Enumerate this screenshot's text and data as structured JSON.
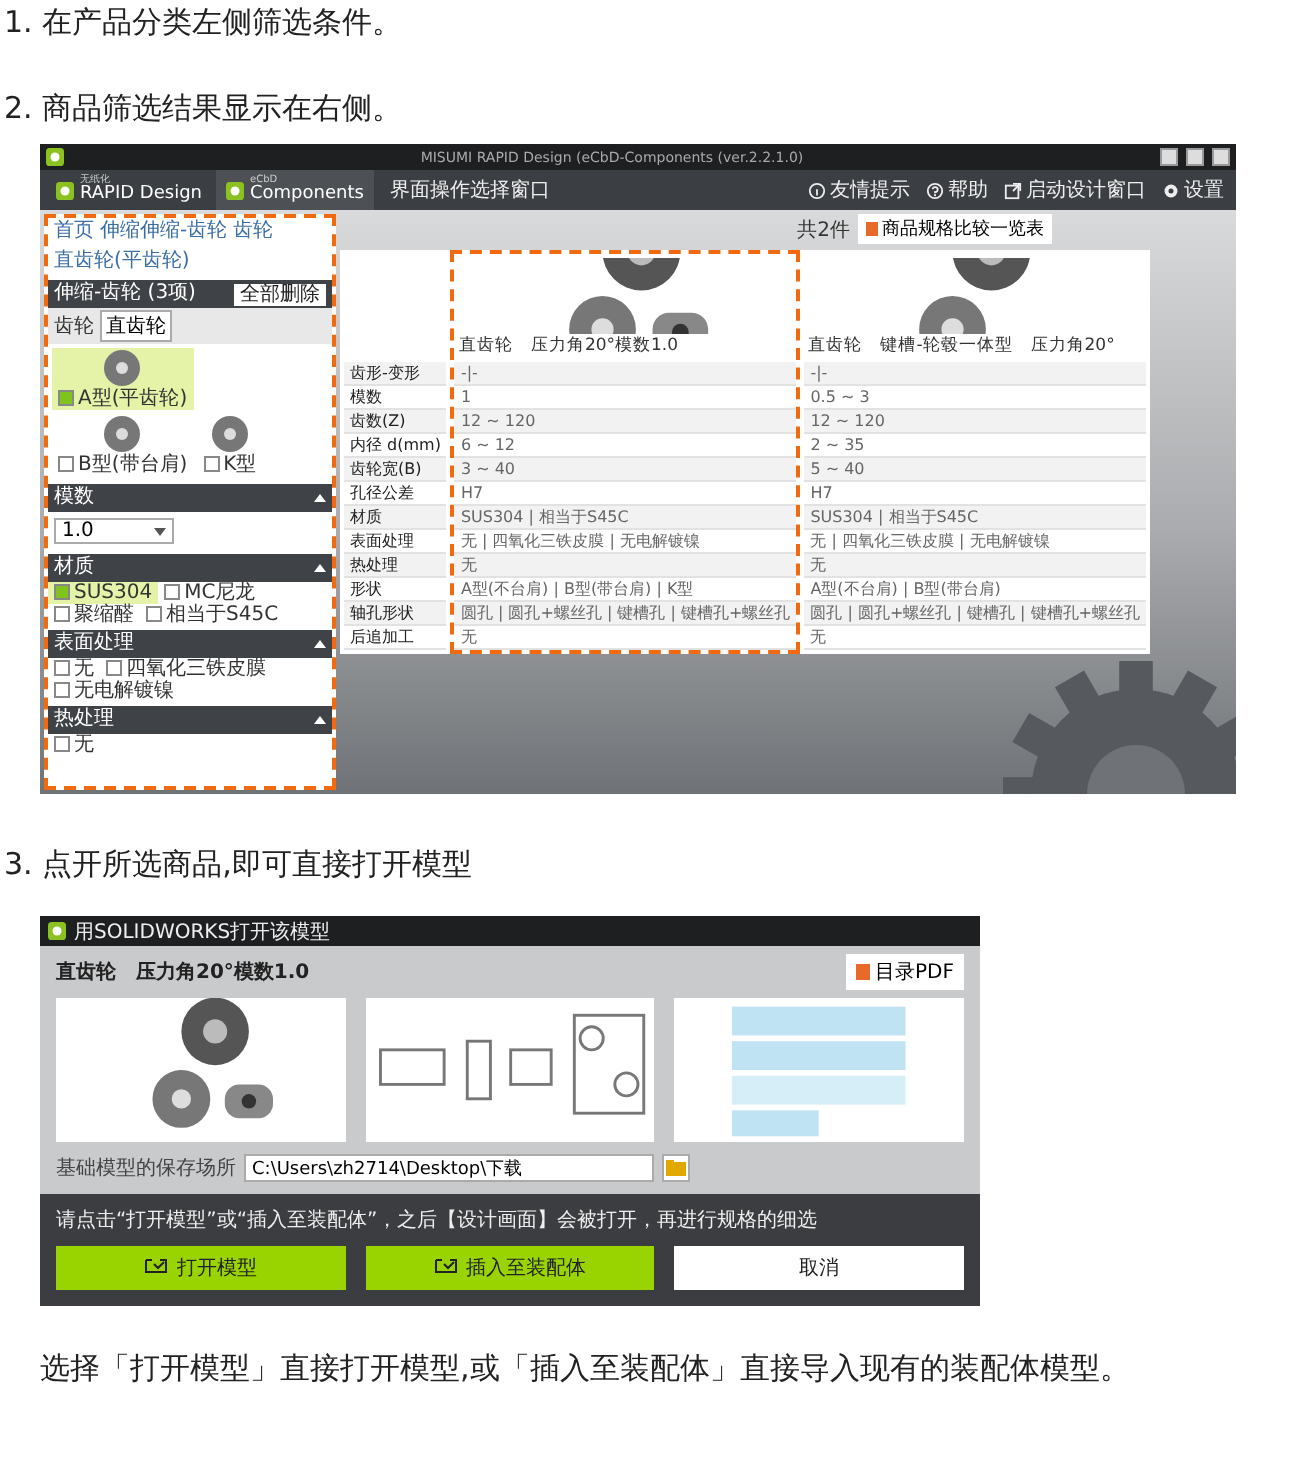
{
  "steps": [
    {
      "text": "1. 在产品分类左侧筛选条件。"
    },
    {
      "text": "2. 商品筛选结果显示在右侧。"
    },
    {
      "text": "3. 点开所选商品,即可直接打开模型"
    }
  ],
  "app_window": {
    "title": "MISUMI RAPID Design (eCbD-Components (ver.2.2.1.0)",
    "tabs": [
      {
        "small": "无纸化",
        "label": "RAPID Design",
        "selected": false
      },
      {
        "small": "eCbD",
        "label": "Components",
        "selected": true
      }
    ],
    "mode_link": "界面操作选择窗口",
    "toolbar": [
      {
        "kind": "info",
        "label": "友情提示"
      },
      {
        "kind": "help",
        "label": "帮助"
      },
      {
        "kind": "launch",
        "label": "启动设计窗口"
      },
      {
        "kind": "settings",
        "label": "设置"
      }
    ],
    "breadcrumb": [
      "首页",
      "伸缩伸缩-齿轮",
      "齿轮",
      "直齿轮(平齿轮)"
    ],
    "filter_panel": {
      "highlighted": true,
      "title": "伸缩-齿轮 (3项)",
      "clear_button": "全部删除",
      "category_label": "齿轮",
      "category_value": "直齿轮",
      "types": [
        {
          "label": "A型(平齿轮)",
          "checked": true
        },
        {
          "label": "B型(带台肩)",
          "checked": false
        },
        {
          "label": "K型",
          "checked": false
        }
      ],
      "sections": [
        {
          "kind": "select",
          "title": "模数",
          "value": "1.0"
        },
        {
          "kind": "checks",
          "title": "材质",
          "options": [
            {
              "label": "SUS304",
              "checked": true
            },
            {
              "label": "MC尼龙",
              "checked": false
            },
            {
              "label": "聚缩醛",
              "checked": false
            },
            {
              "label": "相当于S45C",
              "checked": false
            }
          ]
        },
        {
          "kind": "checks",
          "title": "表面处理",
          "options": [
            {
              "label": "无",
              "checked": false
            },
            {
              "label": "四氧化三铁皮膜",
              "checked": false
            },
            {
              "label": "无电解镀镍",
              "checked": false
            }
          ]
        },
        {
          "kind": "checks",
          "title": "热处理",
          "options": [
            {
              "label": "无",
              "checked": false
            }
          ]
        }
      ]
    },
    "result_count": "共2件",
    "compare_button": "商品规格比较一览表",
    "products": [
      {
        "name": "直齿轮　压力角20°模数1.0",
        "highlighted": true
      },
      {
        "name": "直齿轮　键槽-轮毂一体型　压力角20°",
        "highlighted": false
      }
    ],
    "spec_rows": [
      {
        "label": "齿形-变形",
        "values": [
          "-|-",
          "-|-"
        ]
      },
      {
        "label": "模数",
        "values": [
          "1",
          "0.5 ~ 3"
        ]
      },
      {
        "label": "齿数(Z)",
        "values": [
          "12 ~ 120",
          "12 ~ 120"
        ]
      },
      {
        "label": "内径 d(mm)",
        "values": [
          "6 ~ 12",
          "2 ~ 35"
        ]
      },
      {
        "label": "齿轮宽(B)",
        "values": [
          "3 ~ 40",
          "5 ~ 40"
        ]
      },
      {
        "label": "孔径公差",
        "values": [
          "H7",
          "H7"
        ]
      },
      {
        "label": "材质",
        "values": [
          "SUS304 | 相当于S45C",
          "SUS304 | 相当于S45C"
        ]
      },
      {
        "label": "表面处理",
        "values": [
          "无 | 四氧化三铁皮膜 | 无电解镀镍",
          "无 | 四氧化三铁皮膜 | 无电解镀镍"
        ]
      },
      {
        "label": "热处理",
        "values": [
          "无",
          "无"
        ]
      },
      {
        "label": "形状",
        "values": [
          "A型(不台肩) | B型(带台肩) | K型",
          "A型(不台肩) | B型(带台肩)"
        ]
      },
      {
        "label": "轴孔形状",
        "values": [
          "圆孔 | 圆孔+螺丝孔 | 键槽孔 | 键槽孔+螺丝孔",
          "圆孔 | 圆孔+螺丝孔 | 键槽孔 | 键槽孔+螺丝孔"
        ]
      },
      {
        "label": "后追加工",
        "values": [
          "无",
          "无"
        ]
      }
    ]
  },
  "dialog": {
    "title": "用SOLIDWORKS打开该模型",
    "product_title": "直齿轮　压力角20°模数1.0",
    "pdf_button": "目录PDF",
    "save_label": "基础模型的保存场所",
    "save_path": "C:\\Users\\zh2714\\Desktop\\下载",
    "message": "请点击“打开模型”或“插入至装配体”，之后【设计画面】会被打开，再进行规格的细选",
    "buttons": [
      {
        "kind": "primary",
        "label": "打开模型"
      },
      {
        "kind": "primary",
        "label": "插入至装配体"
      },
      {
        "kind": "secondary",
        "label": "取消"
      }
    ]
  },
  "caption": "选择「打开模型」直接打开模型,或「插入至装配体」直接导入现有的装配体模型。"
}
